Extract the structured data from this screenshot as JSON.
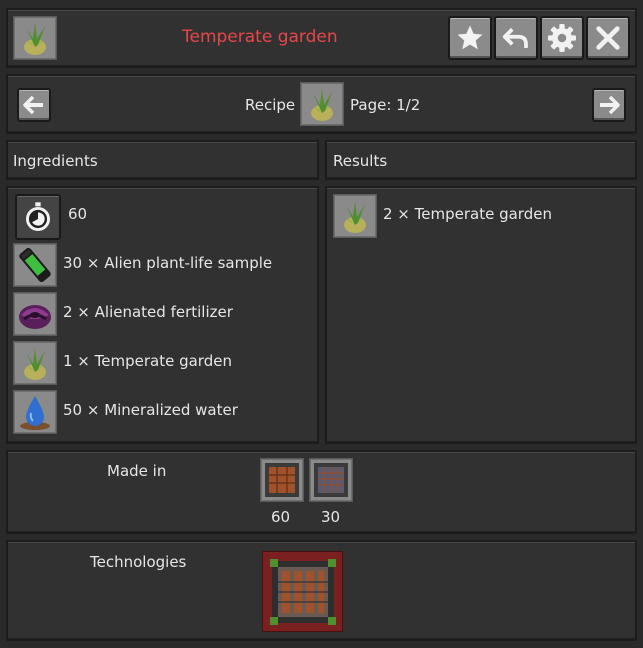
{
  "header": {
    "title": "Temperate garden",
    "title_color": "#e8474a",
    "buttons": [
      "star-icon",
      "back-icon",
      "gear-icon",
      "close-icon"
    ]
  },
  "nav": {
    "recipe_label": "Recipe",
    "page_label": "Page: 1/2",
    "prev_icon": "arrow-left-icon",
    "next_icon": "arrow-right-icon"
  },
  "ingredients": {
    "heading": "Ingredients",
    "items": [
      {
        "text": "60",
        "icon": "stopwatch-icon"
      },
      {
        "text": "30 × Alien plant-life sample",
        "icon": "alien-plant-sample-icon"
      },
      {
        "text": "2 × Alienated fertilizer",
        "icon": "alienated-fertilizer-icon"
      },
      {
        "text": "1 × Temperate garden",
        "icon": "temperate-garden-icon"
      },
      {
        "text": "50 × Mineralized water",
        "icon": "mineralized-water-icon"
      }
    ]
  },
  "results": {
    "heading": "Results",
    "items": [
      {
        "text": "2 × Temperate garden",
        "icon": "temperate-garden-icon"
      }
    ]
  },
  "made_in": {
    "label": "Made in",
    "machines": [
      {
        "value": "60",
        "icon": "greenhouse-icon"
      },
      {
        "value": "30",
        "icon": "greenhouse-mk2-icon"
      }
    ]
  },
  "technologies": {
    "label": "Technologies",
    "icon": "greenhouse-technology-icon"
  }
}
